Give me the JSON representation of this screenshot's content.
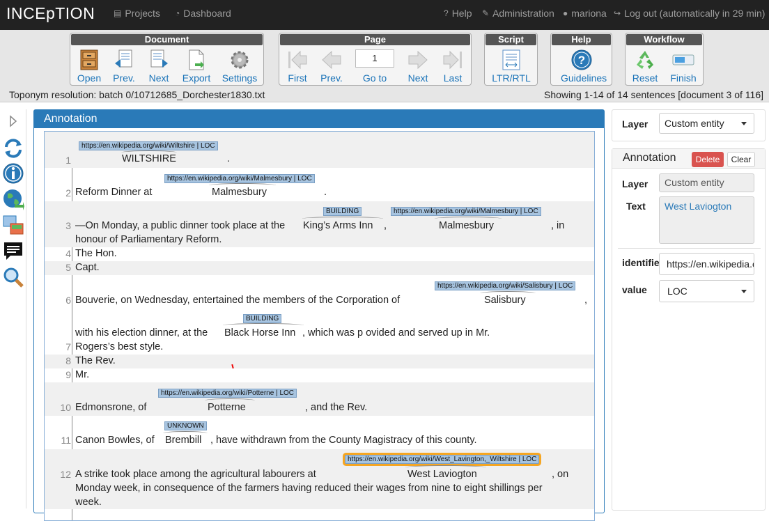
{
  "navbar": {
    "brand": "INCEpTION",
    "projects": "Projects",
    "dashboard": "Dashboard",
    "help": "Help",
    "administration": "Administration",
    "user": "mariona",
    "logout": "Log out (automatically in 29 min)"
  },
  "toolbar": {
    "document": {
      "title": "Document",
      "open": "Open",
      "prev": "Prev.",
      "next": "Next",
      "export": "Export",
      "settings": "Settings"
    },
    "page": {
      "title": "Page",
      "first": "First",
      "prev": "Prev.",
      "goto": "Go to",
      "next": "Next",
      "last": "Last",
      "page_value": "1"
    },
    "script": {
      "title": "Script",
      "ltr_rtl": "LTR/RTL"
    },
    "help": {
      "title": "Help",
      "guidelines": "Guidelines"
    },
    "workflow": {
      "title": "Workflow",
      "reset": "Reset",
      "finish": "Finish"
    }
  },
  "status": {
    "document_path": "Toponym resolution: batch 0/10712685_Dorchester1830.txt",
    "showing": "Showing 1-14 of 14 sentences [document 3 of 116]"
  },
  "annotation_panel": {
    "title": "Annotation",
    "sentences": [
      {
        "num": "1",
        "text": ""
      },
      {
        "num": "2",
        "text": "Reform Dinner at"
      },
      {
        "num": "3",
        "text": "—On Monday, a public dinner took place at the"
      },
      {
        "num": "4",
        "text": "The Hon."
      },
      {
        "num": "5",
        "text": "Capt."
      },
      {
        "num": "6",
        "text": "Bouverie, on Wednesday, entertained the members of the Corporation of"
      },
      {
        "num": "7",
        "text": "Rogers’s best style."
      },
      {
        "num": "8",
        "text": "The Rev."
      },
      {
        "num": "9",
        "text": "Mr."
      },
      {
        "num": "10",
        "text": "Edmonsrone, of"
      },
      {
        "num": "11",
        "text": "Canon Bowles, of"
      },
      {
        "num": "12",
        "text": "A strike took place among the agricultural labourers at"
      }
    ],
    "extra_text": {
      "s1_dot": ".",
      "s2_dot": ".",
      "s3_comma_in": ", in",
      "s3_line2": "honour of Parliamentary Reform.",
      "s3_comma": ",",
      "s6_comma": ",",
      "s6_line2_pre": "with his election dinner, at the",
      "s6_line2_post": ", which was p ovided and served up in Mr.",
      "s10_post": ", and the Rev.",
      "s11_post": ", have withdrawn from the County Magistracy of this county.",
      "s12_post": ", on",
      "s12_line2": "Monday week, in consequence of the farmers having reduced their wages from nine to eight shillings per",
      "s12_line3": "week."
    },
    "tokens": {
      "wiltshire": "WILTSHIRE",
      "malmesbury": "Malmesbury",
      "kings_arms": "King’s Arms Inn",
      "salisbury": "Salisbury",
      "black_horse": "Black Horse Inn",
      "potterne": "Potterne",
      "brembill": "Brembill",
      "west_laviogton": "West Laviogton"
    },
    "labels": {
      "wiltshire": "https://en.wikipedia.org/wiki/Wiltshire | LOC",
      "malmesbury": "https://en.wikipedia.org/wiki/Malmesbury | LOC",
      "building": "BUILDING",
      "salisbury": "https://en.wikipedia.org/wiki/Salisbury | LOC",
      "potterne": "https://en.wikipedia.org/wiki/Potterne | LOC",
      "unknown": "UNKNOWN",
      "west_lavington": "https://en.wikipedia.org/wiki/West_Lavington,_Wiltshire | LOC"
    }
  },
  "layer_panel": {
    "label": "Layer",
    "value": "Custom entity"
  },
  "detail_panel": {
    "title": "Annotation",
    "delete": "Delete",
    "clear": "Clear",
    "layer_label": "Layer",
    "layer_value": "Custom entity",
    "text_label": "Text",
    "text_value": "West Laviogton",
    "identifier_label": "identifier",
    "identifier_value": "https://en.wikipedia.org/wiki/West_Lavington,_Wiltshire",
    "value_label": "value",
    "value_value": "LOC"
  },
  "colors": {
    "navbar": "#222222",
    "panel_accent": "#2a7ab8",
    "tag": "#a7c4e0",
    "selected": "#f5a623",
    "delete": "#d9534f"
  }
}
